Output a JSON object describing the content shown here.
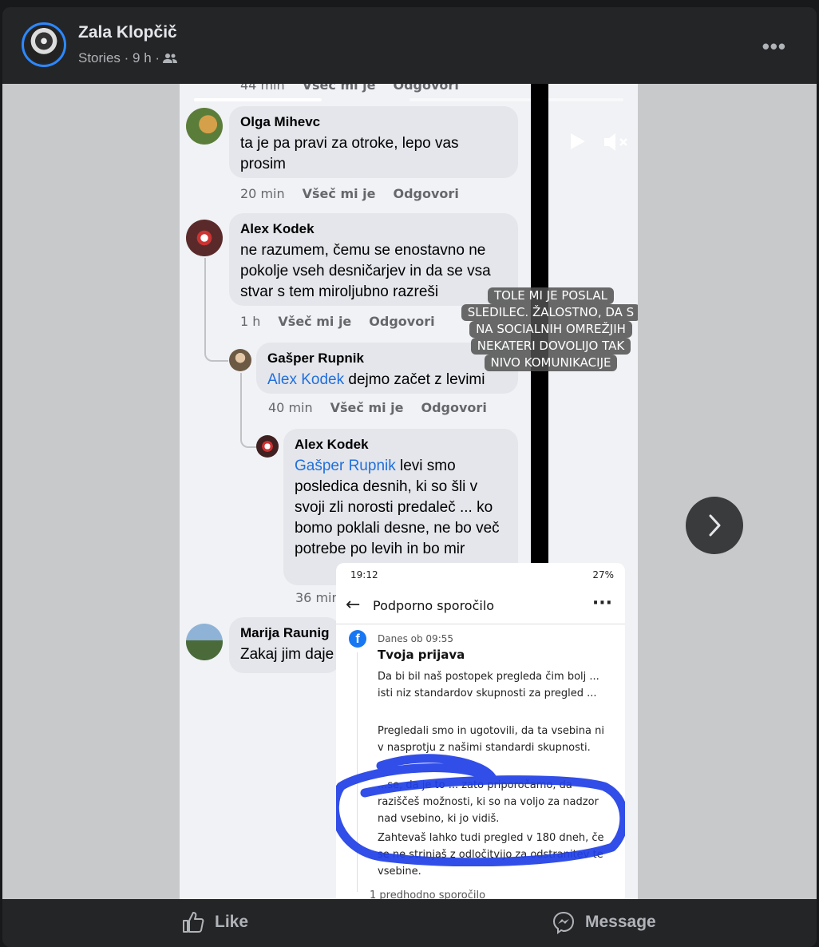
{
  "header": {
    "name": "Zala Klopčič",
    "meta": "Stories · 9 h ·",
    "audience_icon": "friends-icon",
    "more": "•••"
  },
  "story": {
    "top_partial": {
      "time": "44 min",
      "like": "Všeč mi je",
      "reply": "Odgovori"
    },
    "comments": [
      {
        "name": "Olga Mihevc",
        "text": "ta je pa pravi za otroke, lepo vas prosim",
        "time": "20 min",
        "like": "Všeč mi je",
        "reply": "Odgovori"
      },
      {
        "name": "Alex Kodek",
        "text": "ne razumem, čemu se enostavno ne pokolje vseh desničarjev in da se vsa stvar s tem miroljubno razreši",
        "time": "1 h",
        "like": "Všeč mi je",
        "reply": "Odgovori"
      },
      {
        "name": "Gašper Rupnik",
        "mention": "Alex Kodek",
        "text": " dejmo začet z levimi",
        "time": "40 min",
        "like": "Všeč mi je",
        "reply": "Odgovori"
      },
      {
        "name": "Alex Kodek",
        "mention": "Gašper Rupnik",
        "text": " levi smo posledica desnih, ki so šli v svoji zli norosti predaleč ... ko bomo poklali desne, ne bo več potrebe po levih in bo mir",
        "time": "36 min"
      },
      {
        "name": "Marija Raunig",
        "text": "Zakaj jim daje"
      }
    ],
    "caption": [
      "TOLE MI JE POSLAL",
      "SLEDILEC. ŽALOSTNO, DA S",
      "NA SOCIALNIH OMREŽJIH",
      "NEKATERI DOVOLIJO TAK",
      "NIVO KOMUNIKACIJE"
    ],
    "screenshot": {
      "time": "19:12",
      "battery": "27%",
      "title": "Podporno sporočilo",
      "date": "Danes ob 09:55",
      "heading": "Tvoja prijava",
      "p1": "Da bi bil naš postopek pregleda čim bolj ... isti niz standardov skupnosti za pregled ...",
      "p2": "Pregledali smo in ugotovili, da ta vsebina ni v nasprotju z našimi standardi skupnosti.",
      "p3": "...se, da je to ... zato priporočamo, da raziščeš možnosti, ki so na voljo za nadzor nad vsebino, ki jo vidiš.",
      "p4": "Zahtevaš lahko tudi pregled v 180 dneh, če se ne strinjaš z odločitvijo za odstranitev te vsebine.",
      "footer": "1 predhodno sporočilo"
    }
  },
  "footer": {
    "like": "Like",
    "message": "Message"
  }
}
